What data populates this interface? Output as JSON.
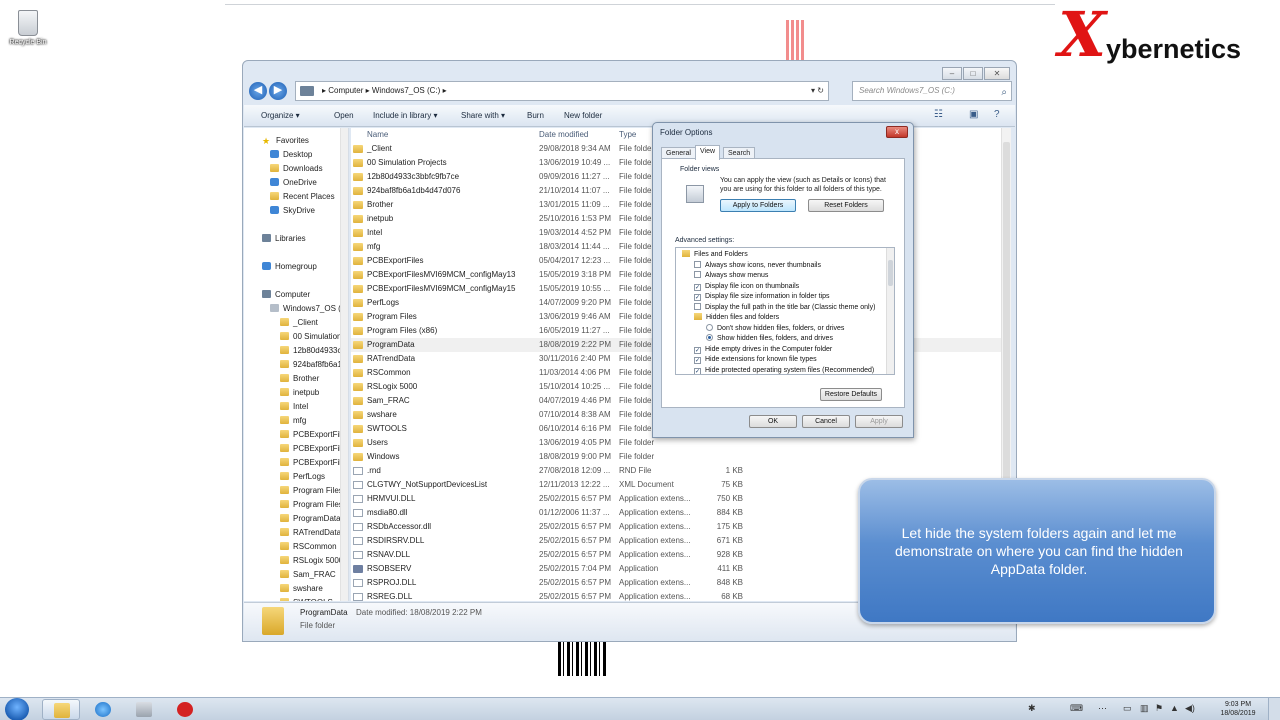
{
  "desktop": {
    "recycle_label": "Recycle Bin",
    "brand_x": "X",
    "brand_word": "ybernetics"
  },
  "explorer": {
    "address": {
      "crumb1": "Computer",
      "crumb2": "Windows7_OS (C:)",
      "sep": "▸"
    },
    "search_placeholder": "Search Windows7_OS (C:)",
    "toolbar": {
      "organize": "Organize ▾",
      "open": "Open",
      "include": "Include in library ▾",
      "share": "Share with ▾",
      "burn": "Burn",
      "new_folder": "New folder"
    },
    "nav": {
      "favorites": "Favorites",
      "desktop": "Desktop",
      "downloads": "Downloads",
      "onedrive": "OneDrive",
      "recent": "Recent Places",
      "skydrive": "SkyDrive",
      "libraries": "Libraries",
      "homegroup": "Homegroup",
      "computer": "Computer",
      "drive": "Windows7_OS (C",
      "tree": [
        "_Client",
        "00 Simulation P",
        "12b80d4933c3b",
        "924baf8fb6a1d",
        "Brother",
        "inetpub",
        "Intel",
        "mfg",
        "PCBExportFiles",
        "PCBExportFiles",
        "PCBExportFiles",
        "PerfLogs",
        "Program Files",
        "Program Files (",
        "ProgramData",
        "RATrendData",
        "RSCommon",
        "RSLogix 5000",
        "Sam_FRAC",
        "swshare",
        "SWTOOLS"
      ]
    },
    "columns": {
      "name": "Name",
      "date": "Date modified",
      "type": "Type"
    },
    "files": [
      {
        "name": "_Client",
        "date": "29/08/2018 9:34 AM",
        "type": "File folde",
        "size": "",
        "kind": "folder"
      },
      {
        "name": "00 Simulation Projects",
        "date": "13/06/2019 10:49 ...",
        "type": "File folde",
        "size": "",
        "kind": "folder"
      },
      {
        "name": "12b80d4933c3bbfc9fb7ce",
        "date": "09/09/2016 11:27 ...",
        "type": "File folde",
        "size": "",
        "kind": "folder"
      },
      {
        "name": "924baf8fb6a1db4d47d076",
        "date": "21/10/2014 11:07 ...",
        "type": "File folde",
        "size": "",
        "kind": "folder"
      },
      {
        "name": "Brother",
        "date": "13/01/2015 11:09 ...",
        "type": "File folde",
        "size": "",
        "kind": "folder"
      },
      {
        "name": "inetpub",
        "date": "25/10/2016 1:53 PM",
        "type": "File folde",
        "size": "",
        "kind": "folder"
      },
      {
        "name": "Intel",
        "date": "19/03/2014 4:52 PM",
        "type": "File folde",
        "size": "",
        "kind": "folder"
      },
      {
        "name": "mfg",
        "date": "18/03/2014 11:44 ...",
        "type": "File folde",
        "size": "",
        "kind": "folder"
      },
      {
        "name": "PCBExportFiles",
        "date": "05/04/2017 12:23 ...",
        "type": "File folde",
        "size": "",
        "kind": "folder"
      },
      {
        "name": "PCBExportFilesMVI69MCM_configMay13",
        "date": "15/05/2019 3:18 PM",
        "type": "File folde",
        "size": "",
        "kind": "folder"
      },
      {
        "name": "PCBExportFilesMVI69MCM_configMay15",
        "date": "15/05/2019 10:55 ...",
        "type": "File folde",
        "size": "",
        "kind": "folder"
      },
      {
        "name": "PerfLogs",
        "date": "14/07/2009 9:20 PM",
        "type": "File folde",
        "size": "",
        "kind": "folder"
      },
      {
        "name": "Program Files",
        "date": "13/06/2019 9:46 AM",
        "type": "File folde",
        "size": "",
        "kind": "folder"
      },
      {
        "name": "Program Files (x86)",
        "date": "16/05/2019 11:27 ...",
        "type": "File folde",
        "size": "",
        "kind": "folder"
      },
      {
        "name": "ProgramData",
        "date": "18/08/2019 2:22 PM",
        "type": "File folde",
        "size": "",
        "kind": "folder"
      },
      {
        "name": "RATrendData",
        "date": "30/11/2016 2:40 PM",
        "type": "File folde",
        "size": "",
        "kind": "folder"
      },
      {
        "name": "RSCommon",
        "date": "11/03/2014 4:06 PM",
        "type": "File folde",
        "size": "",
        "kind": "folder"
      },
      {
        "name": "RSLogix 5000",
        "date": "15/10/2014 10:25 ...",
        "type": "File folde",
        "size": "",
        "kind": "folder"
      },
      {
        "name": "Sam_FRAC",
        "date": "04/07/2019 4:46 PM",
        "type": "File folde",
        "size": "",
        "kind": "folder"
      },
      {
        "name": "swshare",
        "date": "07/10/2014 8:38 AM",
        "type": "File folde",
        "size": "",
        "kind": "folder"
      },
      {
        "name": "SWTOOLS",
        "date": "06/10/2014 6:16 PM",
        "type": "File folde",
        "size": "",
        "kind": "folder"
      },
      {
        "name": "Users",
        "date": "13/06/2019 4:05 PM",
        "type": "File folder",
        "size": "",
        "kind": "folder"
      },
      {
        "name": "Windows",
        "date": "18/08/2019 9:00 PM",
        "type": "File folder",
        "size": "",
        "kind": "folder"
      },
      {
        "name": ".rnd",
        "date": "27/08/2018 12:09 ...",
        "type": "RND File",
        "size": "1 KB",
        "kind": "file"
      },
      {
        "name": "CLGTWY_NotSupportDevicesList",
        "date": "12/11/2013 12:22 ...",
        "type": "XML Document",
        "size": "75 KB",
        "kind": "file"
      },
      {
        "name": "HRMVUI.DLL",
        "date": "25/02/2015 6:57 PM",
        "type": "Application extens...",
        "size": "750 KB",
        "kind": "file"
      },
      {
        "name": "msdia80.dll",
        "date": "01/12/2006 11:37 ...",
        "type": "Application extens...",
        "size": "884 KB",
        "kind": "file"
      },
      {
        "name": "RSDbAccessor.dll",
        "date": "25/02/2015 6:57 PM",
        "type": "Application extens...",
        "size": "175 KB",
        "kind": "file"
      },
      {
        "name": "RSDIRSRV.DLL",
        "date": "25/02/2015 6:57 PM",
        "type": "Application extens...",
        "size": "671 KB",
        "kind": "file"
      },
      {
        "name": "RSNAV.DLL",
        "date": "25/02/2015 6:57 PM",
        "type": "Application extens...",
        "size": "928 KB",
        "kind": "file"
      },
      {
        "name": "RSOBSERV",
        "date": "25/02/2015 7:04 PM",
        "type": "Application",
        "size": "411 KB",
        "kind": "app"
      },
      {
        "name": "RSPROJ.DLL",
        "date": "25/02/2015 6:57 PM",
        "type": "Application extens...",
        "size": "848 KB",
        "kind": "file"
      },
      {
        "name": "RSREG.DLL",
        "date": "25/02/2015 6:57 PM",
        "type": "Application extens...",
        "size": "68 KB",
        "kind": "file"
      }
    ],
    "details": {
      "name": "ProgramData",
      "modified": "Date modified: 18/08/2019 2:22 PM",
      "kind": "File folder"
    }
  },
  "dialog": {
    "title": "Folder Options",
    "close": "x",
    "tabs": [
      "General",
      "View",
      "Search"
    ],
    "folder_views_label": "Folder views",
    "folder_views_text": "You can apply the view (such as Details or Icons) that you are using for this folder to all folders of this type.",
    "apply_to_folders": "Apply to Folders",
    "reset_folders": "Reset Folders",
    "advanced_label": "Advanced settings:",
    "settings": [
      {
        "label": "Files and Folders",
        "kind": "folder",
        "indent": 0,
        "checked": ""
      },
      {
        "label": "Always show icons, never thumbnails",
        "kind": "check",
        "indent": 1,
        "checked": ""
      },
      {
        "label": "Always show menus",
        "kind": "check",
        "indent": 1,
        "checked": ""
      },
      {
        "label": "Display file icon on thumbnails",
        "kind": "check",
        "indent": 1,
        "checked": "✓"
      },
      {
        "label": "Display file size information in folder tips",
        "kind": "check",
        "indent": 1,
        "checked": "✓"
      },
      {
        "label": "Display the full path in the title bar (Classic theme only)",
        "kind": "check",
        "indent": 1,
        "checked": ""
      },
      {
        "label": "Hidden files and folders",
        "kind": "folder",
        "indent": 1,
        "checked": ""
      },
      {
        "label": "Don't show hidden files, folders, or drives",
        "kind": "radio",
        "indent": 2,
        "checked": ""
      },
      {
        "label": "Show hidden files, folders, and drives",
        "kind": "radio",
        "indent": 2,
        "checked": "on"
      },
      {
        "label": "Hide empty drives in the Computer folder",
        "kind": "check",
        "indent": 1,
        "checked": "✓"
      },
      {
        "label": "Hide extensions for known file types",
        "kind": "check",
        "indent": 1,
        "checked": "✓"
      },
      {
        "label": "Hide protected operating system files (Recommended)",
        "kind": "check",
        "indent": 1,
        "checked": "✓"
      }
    ],
    "restore_defaults": "Restore Defaults",
    "ok": "OK",
    "cancel": "Cancel",
    "apply": "Apply"
  },
  "callout": {
    "text": "Let hide the system folders again and let me demonstrate on where you can find the hidden AppData folder."
  },
  "taskbar": {
    "time": "9:03 PM",
    "date": "18/08/2019"
  }
}
